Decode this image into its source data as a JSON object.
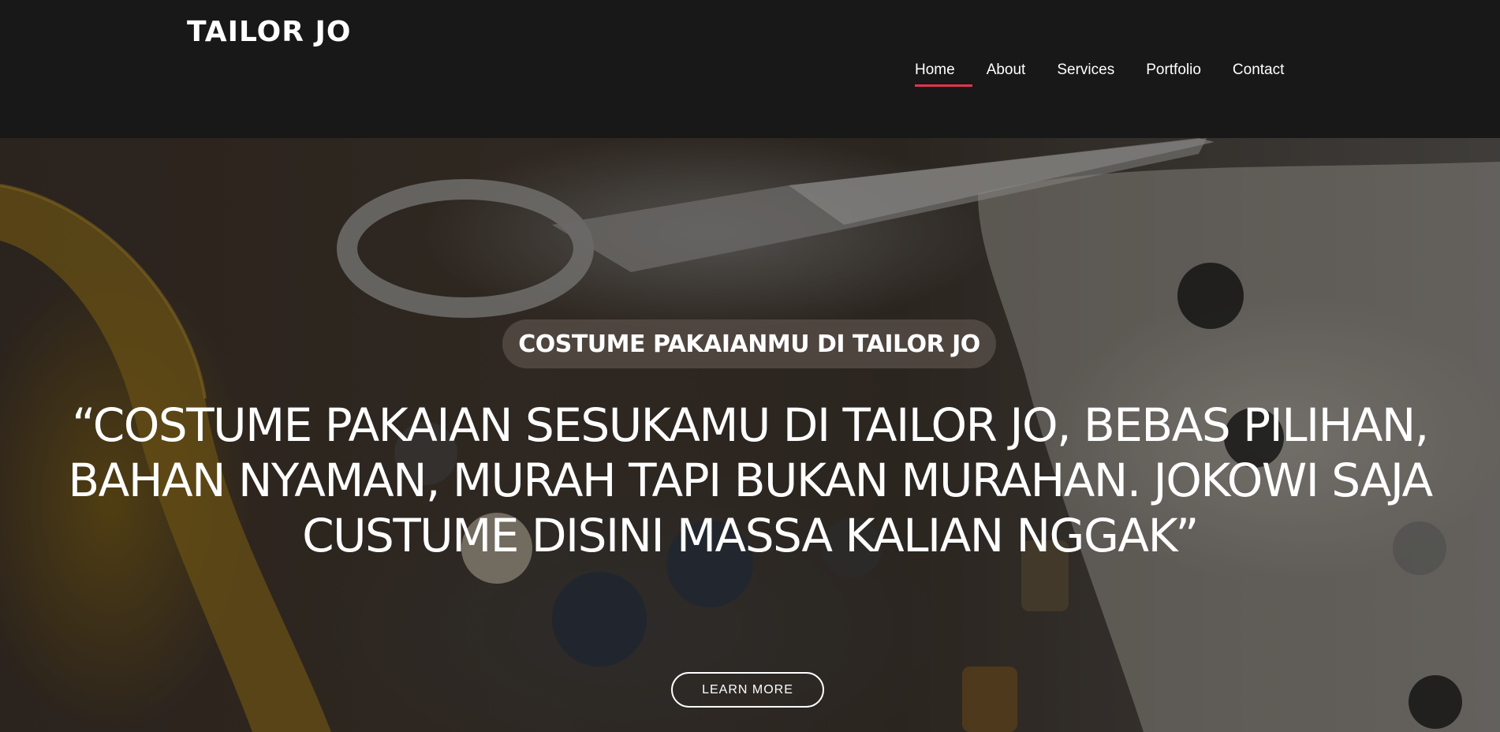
{
  "header": {
    "logo": "TAILOR JO",
    "nav": [
      {
        "label": "Home",
        "active": true
      },
      {
        "label": "About"
      },
      {
        "label": "Services"
      },
      {
        "label": "Portfolio"
      },
      {
        "label": "Contact"
      }
    ]
  },
  "hero": {
    "badge": "COSTUME PAKAIANMU DI TAILOR JO",
    "quote_lines": [
      "“COSTUME PAKAIAN SESUKAMU DI TAILOR JO, BEBAS PILIHAN,",
      "BAHAN NYAMAN, MURAH TAPI BUKAN MURAHAN. JOKOWI SAJA",
      "CUSTUME DISINI MASSA KALIAN NGGAK”"
    ],
    "cta_label": "LEARN MORE",
    "background_image": "tailoring-tools-icon"
  },
  "colors": {
    "nav_active_underline": "#e0344f",
    "header_bg": "#181818"
  }
}
